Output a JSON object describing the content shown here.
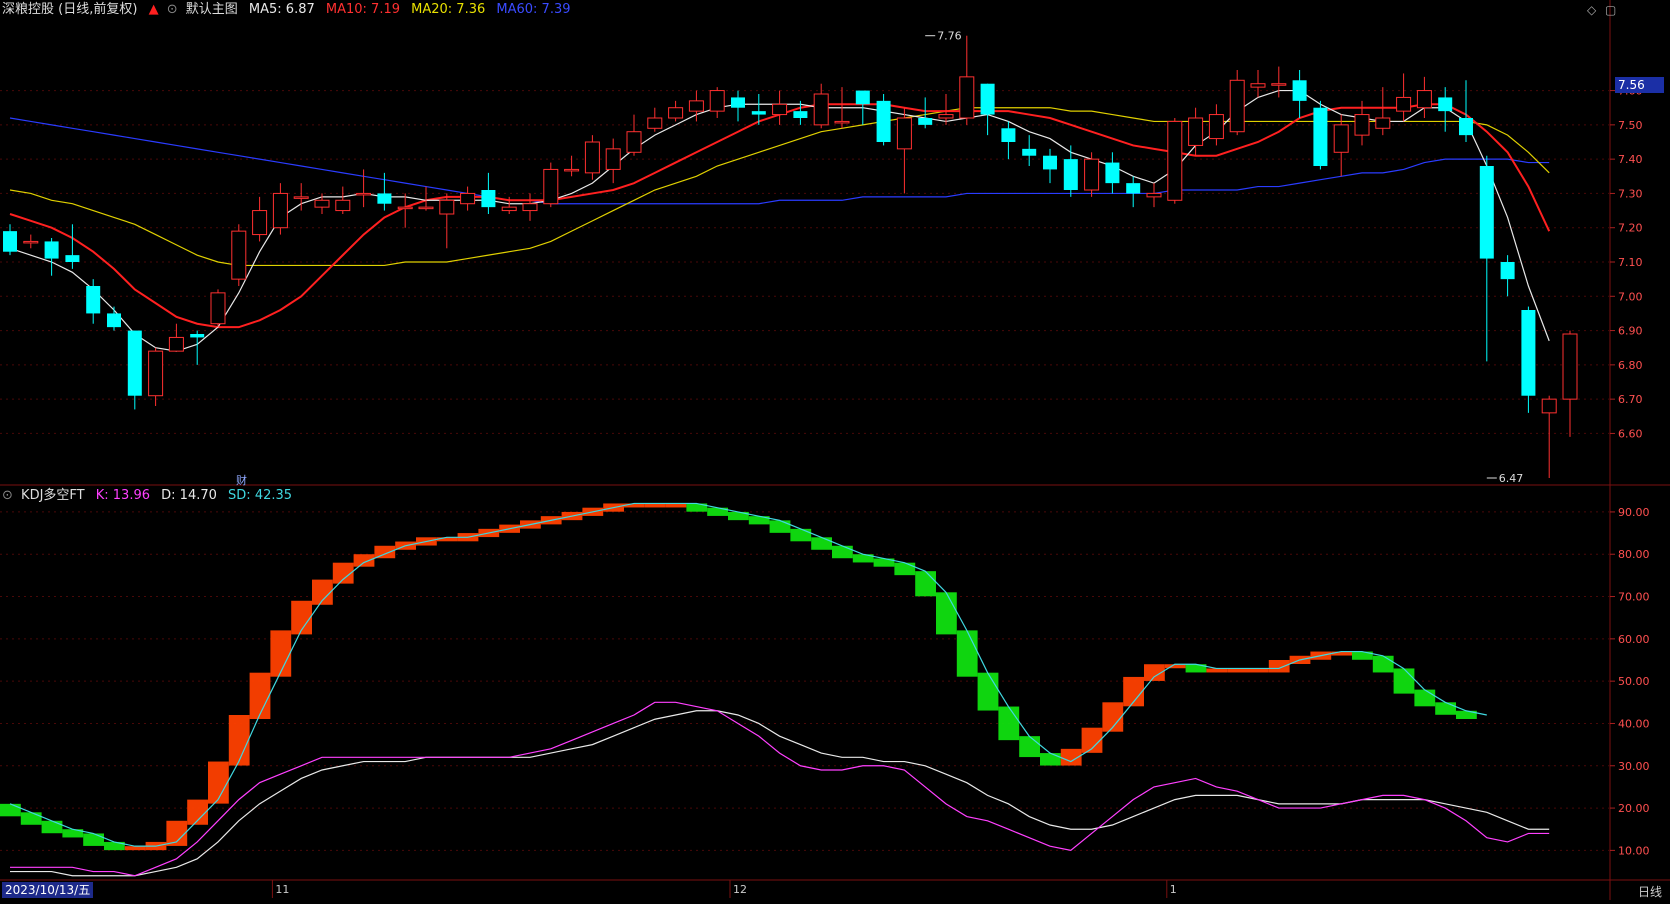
{
  "header": {
    "stock_title": "深粮控股 (日线,前复权)",
    "template": "默认主图",
    "ma_labels": [
      {
        "text": "MA5: 6.87",
        "color": "#e8e8e8"
      },
      {
        "text": "MA10: 7.19",
        "color": "#ff3030"
      },
      {
        "text": "MA20: 7.36",
        "color": "#e8e000"
      },
      {
        "text": "MA60: 7.39",
        "color": "#3a4bff"
      }
    ]
  },
  "sub_header": {
    "title": "KDJ多空FT",
    "labels": [
      {
        "text": "K: 13.96",
        "color": "#ff40ff"
      },
      {
        "text": "D: 14.70",
        "color": "#e8e8e8"
      },
      {
        "text": "SD: 42.35",
        "color": "#40d8e0"
      }
    ]
  },
  "current_price": "7.56",
  "date_label": "2023/10/13/五",
  "cycle_label": "日线",
  "fin_marker": "财",
  "chart_data": [
    {
      "type": "candlestick",
      "ylim": [
        6.47,
        7.8
      ],
      "y_ticks": [
        "7.60",
        "7.50",
        "7.40",
        "7.30",
        "7.20",
        "7.10",
        "7.00",
        "6.90",
        "6.80",
        "6.70",
        "6.60"
      ],
      "x_ticks": [
        "11",
        "12",
        "1"
      ],
      "x_tick_index": [
        13,
        35,
        56
      ],
      "annotations": [
        {
          "text": "7.76",
          "index": 44,
          "value": 7.76
        },
        {
          "text": "6.47",
          "index": 71,
          "value": 6.47
        }
      ],
      "colors": {
        "up": "#ff3030",
        "down": "#00ffff",
        "ma5": "#e8e8e8",
        "ma10": "#ff2020",
        "ma20": "#e0d000",
        "ma60": "#2a3cff"
      },
      "candles": [
        [
          7.19,
          7.13,
          7.21,
          7.12
        ],
        [
          7.16,
          7.16,
          7.18,
          7.14
        ],
        [
          7.16,
          7.11,
          7.17,
          7.06
        ],
        [
          7.12,
          7.1,
          7.21,
          7.08
        ],
        [
          7.03,
          6.95,
          7.05,
          6.92
        ],
        [
          6.95,
          6.91,
          6.97,
          6.9
        ],
        [
          6.9,
          6.71,
          6.9,
          6.67
        ],
        [
          6.71,
          6.84,
          6.85,
          6.68
        ],
        [
          6.84,
          6.88,
          6.92,
          6.84
        ],
        [
          6.89,
          6.88,
          6.9,
          6.8
        ],
        [
          6.92,
          7.01,
          7.02,
          6.91
        ],
        [
          7.05,
          7.19,
          7.21,
          7.03
        ],
        [
          7.18,
          7.25,
          7.29,
          7.16
        ],
        [
          7.2,
          7.3,
          7.33,
          7.18
        ],
        [
          7.29,
          7.29,
          7.33,
          7.25
        ],
        [
          7.26,
          7.28,
          7.3,
          7.24
        ],
        [
          7.25,
          7.28,
          7.32,
          7.24
        ],
        [
          7.3,
          7.3,
          7.37,
          7.26
        ],
        [
          7.3,
          7.27,
          7.36,
          7.25
        ],
        [
          7.26,
          7.26,
          7.3,
          7.2
        ],
        [
          7.26,
          7.26,
          7.32,
          7.25
        ],
        [
          7.24,
          7.28,
          7.3,
          7.14
        ],
        [
          7.27,
          7.3,
          7.32,
          7.25
        ],
        [
          7.31,
          7.26,
          7.36,
          7.24
        ],
        [
          7.25,
          7.26,
          7.29,
          7.24
        ],
        [
          7.25,
          7.27,
          7.3,
          7.22
        ],
        [
          7.27,
          7.37,
          7.39,
          7.26
        ],
        [
          7.37,
          7.37,
          7.41,
          7.35
        ],
        [
          7.36,
          7.45,
          7.47,
          7.34
        ],
        [
          7.37,
          7.43,
          7.46,
          7.33
        ],
        [
          7.42,
          7.48,
          7.53,
          7.41
        ],
        [
          7.49,
          7.52,
          7.55,
          7.48
        ],
        [
          7.52,
          7.55,
          7.57,
          7.51
        ],
        [
          7.54,
          7.57,
          7.6,
          7.51
        ],
        [
          7.54,
          7.6,
          7.61,
          7.52
        ],
        [
          7.58,
          7.55,
          7.6,
          7.51
        ],
        [
          7.54,
          7.53,
          7.59,
          7.5
        ],
        [
          7.53,
          7.56,
          7.6,
          7.5
        ],
        [
          7.54,
          7.52,
          7.57,
          7.5
        ],
        [
          7.5,
          7.59,
          7.62,
          7.49
        ],
        [
          7.51,
          7.51,
          7.61,
          7.49
        ],
        [
          7.6,
          7.56,
          7.59,
          7.5
        ],
        [
          7.57,
          7.45,
          7.59,
          7.44
        ],
        [
          7.43,
          7.52,
          7.55,
          7.3
        ],
        [
          7.52,
          7.5,
          7.58,
          7.49
        ],
        [
          7.52,
          7.53,
          7.59,
          7.5
        ],
        [
          7.52,
          7.64,
          7.76,
          7.5
        ],
        [
          7.62,
          7.53,
          7.62,
          7.47
        ],
        [
          7.49,
          7.45,
          7.51,
          7.4
        ],
        [
          7.43,
          7.41,
          7.47,
          7.38
        ],
        [
          7.41,
          7.37,
          7.43,
          7.33
        ],
        [
          7.4,
          7.31,
          7.44,
          7.29
        ],
        [
          7.31,
          7.4,
          7.42,
          7.29
        ],
        [
          7.39,
          7.33,
          7.42,
          7.3
        ],
        [
          7.33,
          7.3,
          7.35,
          7.26
        ],
        [
          7.29,
          7.3,
          7.33,
          7.26
        ],
        [
          7.28,
          7.51,
          7.52,
          7.27
        ],
        [
          7.44,
          7.52,
          7.55,
          7.41
        ],
        [
          7.46,
          7.53,
          7.56,
          7.44
        ],
        [
          7.48,
          7.63,
          7.66,
          7.47
        ],
        [
          7.61,
          7.62,
          7.66,
          7.58
        ],
        [
          7.62,
          7.62,
          7.67,
          7.58
        ],
        [
          7.63,
          7.57,
          7.66,
          7.52
        ],
        [
          7.55,
          7.38,
          7.57,
          7.37
        ],
        [
          7.42,
          7.5,
          7.53,
          7.35
        ],
        [
          7.47,
          7.53,
          7.57,
          7.44
        ],
        [
          7.49,
          7.52,
          7.61,
          7.47
        ],
        [
          7.54,
          7.58,
          7.65,
          7.51
        ],
        [
          7.55,
          7.6,
          7.64,
          7.52
        ],
        [
          7.58,
          7.54,
          7.61,
          7.48
        ],
        [
          7.52,
          7.47,
          7.63,
          7.45
        ],
        [
          7.38,
          7.11,
          7.41,
          6.81
        ],
        [
          7.1,
          7.05,
          7.12,
          7.0
        ],
        [
          6.96,
          6.71,
          6.97,
          6.66
        ],
        [
          6.66,
          6.7,
          6.71,
          6.47
        ],
        [
          6.7,
          6.89,
          6.9,
          6.59
        ]
      ],
      "ma5": [
        7.14,
        7.12,
        7.1,
        7.07,
        7.02,
        6.96,
        6.89,
        6.85,
        6.84,
        6.86,
        6.91,
        7.01,
        7.13,
        7.23,
        7.27,
        7.29,
        7.29,
        7.3,
        7.29,
        7.29,
        7.28,
        7.28,
        7.28,
        7.28,
        7.27,
        7.27,
        7.28,
        7.3,
        7.33,
        7.38,
        7.43,
        7.47,
        7.5,
        7.53,
        7.55,
        7.56,
        7.56,
        7.56,
        7.56,
        7.55,
        7.55,
        7.55,
        7.54,
        7.53,
        7.52,
        7.51,
        7.52,
        7.53,
        7.51,
        7.48,
        7.46,
        7.42,
        7.4,
        7.38,
        7.35,
        7.33,
        7.37,
        7.44,
        7.48,
        7.54,
        7.58,
        7.6,
        7.6,
        7.56,
        7.53,
        7.52,
        7.51,
        7.51,
        7.55,
        7.55,
        7.51,
        7.38,
        7.23,
        7.03,
        6.87
      ],
      "ma10": [
        7.24,
        7.22,
        7.2,
        7.17,
        7.13,
        7.08,
        7.02,
        6.98,
        6.94,
        6.92,
        6.91,
        6.91,
        6.93,
        6.96,
        7.0,
        7.06,
        7.12,
        7.18,
        7.23,
        7.26,
        7.28,
        7.29,
        7.29,
        7.29,
        7.28,
        7.28,
        7.28,
        7.29,
        7.3,
        7.31,
        7.33,
        7.36,
        7.39,
        7.42,
        7.45,
        7.48,
        7.51,
        7.53,
        7.55,
        7.56,
        7.56,
        7.56,
        7.56,
        7.55,
        7.54,
        7.54,
        7.54,
        7.54,
        7.54,
        7.53,
        7.52,
        7.5,
        7.48,
        7.46,
        7.44,
        7.43,
        7.42,
        7.41,
        7.41,
        7.43,
        7.45,
        7.48,
        7.52,
        7.54,
        7.55,
        7.55,
        7.55,
        7.55,
        7.56,
        7.56,
        7.53,
        7.48,
        7.42,
        7.32,
        7.19
      ],
      "ma20": [
        7.31,
        7.3,
        7.28,
        7.27,
        7.25,
        7.23,
        7.21,
        7.18,
        7.15,
        7.12,
        7.1,
        7.09,
        7.09,
        7.09,
        7.09,
        7.09,
        7.09,
        7.09,
        7.09,
        7.1,
        7.1,
        7.1,
        7.11,
        7.12,
        7.13,
        7.14,
        7.16,
        7.19,
        7.22,
        7.25,
        7.28,
        7.31,
        7.33,
        7.35,
        7.38,
        7.4,
        7.42,
        7.44,
        7.46,
        7.48,
        7.49,
        7.5,
        7.51,
        7.52,
        7.53,
        7.54,
        7.55,
        7.55,
        7.55,
        7.55,
        7.55,
        7.54,
        7.54,
        7.53,
        7.52,
        7.51,
        7.51,
        7.51,
        7.51,
        7.51,
        7.51,
        7.51,
        7.51,
        7.51,
        7.51,
        7.51,
        7.51,
        7.51,
        7.51,
        7.51,
        7.51,
        7.5,
        7.47,
        7.42,
        7.36
      ],
      "ma60": [
        7.52,
        7.51,
        7.5,
        7.49,
        7.48,
        7.47,
        7.46,
        7.45,
        7.44,
        7.43,
        7.42,
        7.41,
        7.4,
        7.39,
        7.38,
        7.37,
        7.36,
        7.35,
        7.34,
        7.33,
        7.32,
        7.31,
        7.3,
        7.29,
        7.28,
        7.28,
        7.27,
        7.27,
        7.27,
        7.27,
        7.27,
        7.27,
        7.27,
        7.27,
        7.27,
        7.27,
        7.27,
        7.28,
        7.28,
        7.28,
        7.28,
        7.29,
        7.29,
        7.29,
        7.29,
        7.29,
        7.3,
        7.3,
        7.3,
        7.3,
        7.3,
        7.3,
        7.3,
        7.3,
        7.3,
        7.3,
        7.31,
        7.31,
        7.31,
        7.31,
        7.32,
        7.32,
        7.33,
        7.34,
        7.35,
        7.36,
        7.36,
        7.37,
        7.39,
        7.4,
        7.4,
        7.4,
        7.4,
        7.39,
        7.39
      ]
    },
    {
      "type": "indicator",
      "ylim": [
        3,
        94
      ],
      "y_ticks": [
        "90.00",
        "80.00",
        "70.00",
        "60.00",
        "50.00",
        "40.00",
        "30.00",
        "20.00",
        "10.00"
      ],
      "colors": {
        "k": "#ff40ff",
        "d": "#e8e8e8",
        "sd": "#40d8e0",
        "bull": "#ff4000",
        "bear": "#10e010"
      },
      "k": [
        6,
        6,
        6,
        6,
        5,
        5,
        4,
        6,
        8,
        12,
        17,
        22,
        26,
        28,
        30,
        32,
        32,
        32,
        32,
        32,
        32,
        32,
        32,
        32,
        32,
        33,
        34,
        36,
        38,
        40,
        42,
        45,
        45,
        44,
        43,
        40,
        37,
        33,
        30,
        29,
        29,
        30,
        30,
        29,
        25,
        21,
        18,
        17,
        15,
        13,
        11,
        10,
        14,
        18,
        22,
        25,
        26,
        27,
        25,
        24,
        22,
        20,
        20,
        20,
        21,
        22,
        23,
        23,
        22,
        20,
        17,
        13,
        12,
        14,
        14
      ],
      "d": [
        5,
        5,
        5,
        4,
        4,
        4,
        4,
        5,
        6,
        8,
        12,
        17,
        21,
        24,
        27,
        29,
        30,
        31,
        31,
        31,
        32,
        32,
        32,
        32,
        32,
        32,
        33,
        34,
        35,
        37,
        39,
        41,
        42,
        43,
        43,
        42,
        40,
        37,
        35,
        33,
        32,
        32,
        31,
        31,
        30,
        28,
        26,
        23,
        21,
        18,
        16,
        15,
        15,
        16,
        18,
        20,
        22,
        23,
        23,
        23,
        22,
        21,
        21,
        21,
        21,
        22,
        22,
        22,
        22,
        21,
        20,
        19,
        17,
        15,
        15
      ],
      "sd": [
        21,
        19,
        17,
        15,
        14,
        12,
        11,
        11,
        12,
        17,
        22,
        31,
        42,
        52,
        62,
        69,
        74,
        78,
        80,
        82,
        83,
        84,
        84,
        85,
        86,
        87,
        88,
        89,
        90,
        91,
        92,
        92,
        92,
        92,
        91,
        90,
        89,
        88,
        86,
        84,
        82,
        80,
        79,
        78,
        76,
        71,
        62,
        52,
        44,
        37,
        33,
        31,
        34,
        39,
        45,
        51,
        54,
        54,
        53,
        53,
        53,
        53,
        55,
        56,
        57,
        57,
        56,
        53,
        48,
        45,
        43,
        42
      ]
    }
  ]
}
